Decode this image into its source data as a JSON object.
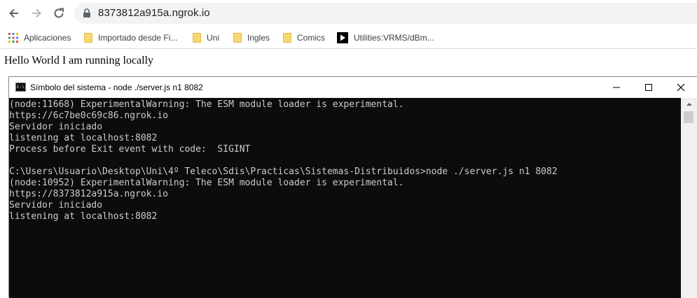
{
  "browser": {
    "url": "8373812a915a.ngrok.io",
    "bookmarks": [
      {
        "label": "Aplicaciones",
        "icon": "apps-grid-icon"
      },
      {
        "label": "Importado desde Fi...",
        "icon": "folder-icon"
      },
      {
        "label": "Uni",
        "icon": "folder-icon"
      },
      {
        "label": "Ingles",
        "icon": "folder-icon"
      },
      {
        "label": "Comics",
        "icon": "folder-icon"
      },
      {
        "label": "Utilities:VRMS/dBm...",
        "icon": "play-icon"
      }
    ]
  },
  "page": {
    "text": "Hello World I am running locally"
  },
  "console": {
    "title": "Símbolo del sistema - node  ./server.js n1 8082",
    "icon_text": "C:\\.",
    "lines": [
      "(node:11668) ExperimentalWarning: The ESM module loader is experimental.",
      "https://6c7be0c69c86.ngrok.io",
      "Servidor iniciado",
      "listening at localhost:8082",
      "Process before Exit event with code:  SIGINT",
      "",
      "C:\\Users\\Usuario\\Desktop\\Uni\\4º Teleco\\Sdis\\Practicas\\Sistemas-Distribuidos>node ./server.js n1 8082",
      "(node:10952) ExperimentalWarning: The ESM module loader is experimental.",
      "https://8373812a915a.ngrok.io",
      "Servidor iniciado",
      "listening at localhost:8082"
    ]
  },
  "colors": {
    "terminal_bg": "#0c0c0c",
    "terminal_fg": "#cccccc",
    "folder": "#f7d774"
  }
}
